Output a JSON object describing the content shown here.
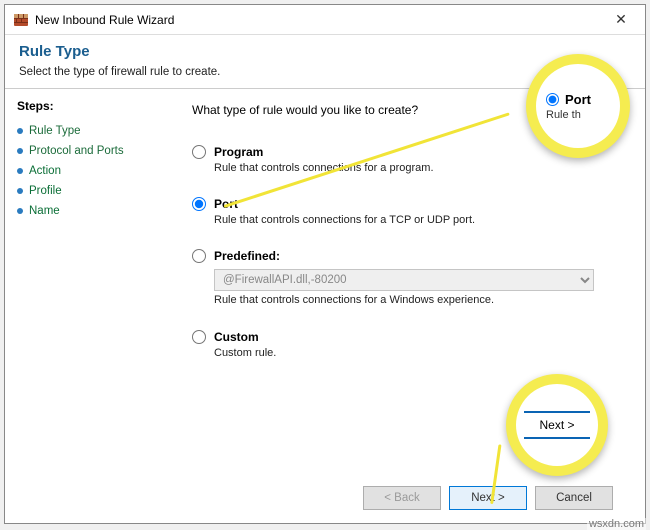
{
  "window": {
    "title": "New Inbound Rule Wizard",
    "close_glyph": "✕"
  },
  "header": {
    "title": "Rule Type",
    "subtitle": "Select the type of firewall rule to create."
  },
  "steps": {
    "heading": "Steps:",
    "items": [
      {
        "label": "Rule Type"
      },
      {
        "label": "Protocol and Ports"
      },
      {
        "label": "Action"
      },
      {
        "label": "Profile"
      },
      {
        "label": "Name"
      }
    ]
  },
  "main": {
    "question": "What type of rule would you like to create?",
    "options": {
      "program": {
        "label": "Program",
        "desc": "Rule that controls connections for a program."
      },
      "port": {
        "label": "Port",
        "desc": "Rule that controls connections for a TCP or UDP port."
      },
      "predefined": {
        "label": "Predefined",
        "select_value": "@FirewallAPI.dll,-80200",
        "desc": "Rule that controls connections for a Windows experience."
      },
      "custom": {
        "label": "Custom",
        "desc": "Custom rule."
      }
    },
    "selected": "port"
  },
  "footer": {
    "back": "< Back",
    "next": "Next >",
    "cancel": "Cancel"
  },
  "annotations": {
    "port_label": "Port",
    "port_sub": "Rule th",
    "next_label": "Next >"
  },
  "watermark": "wsxdn.com"
}
